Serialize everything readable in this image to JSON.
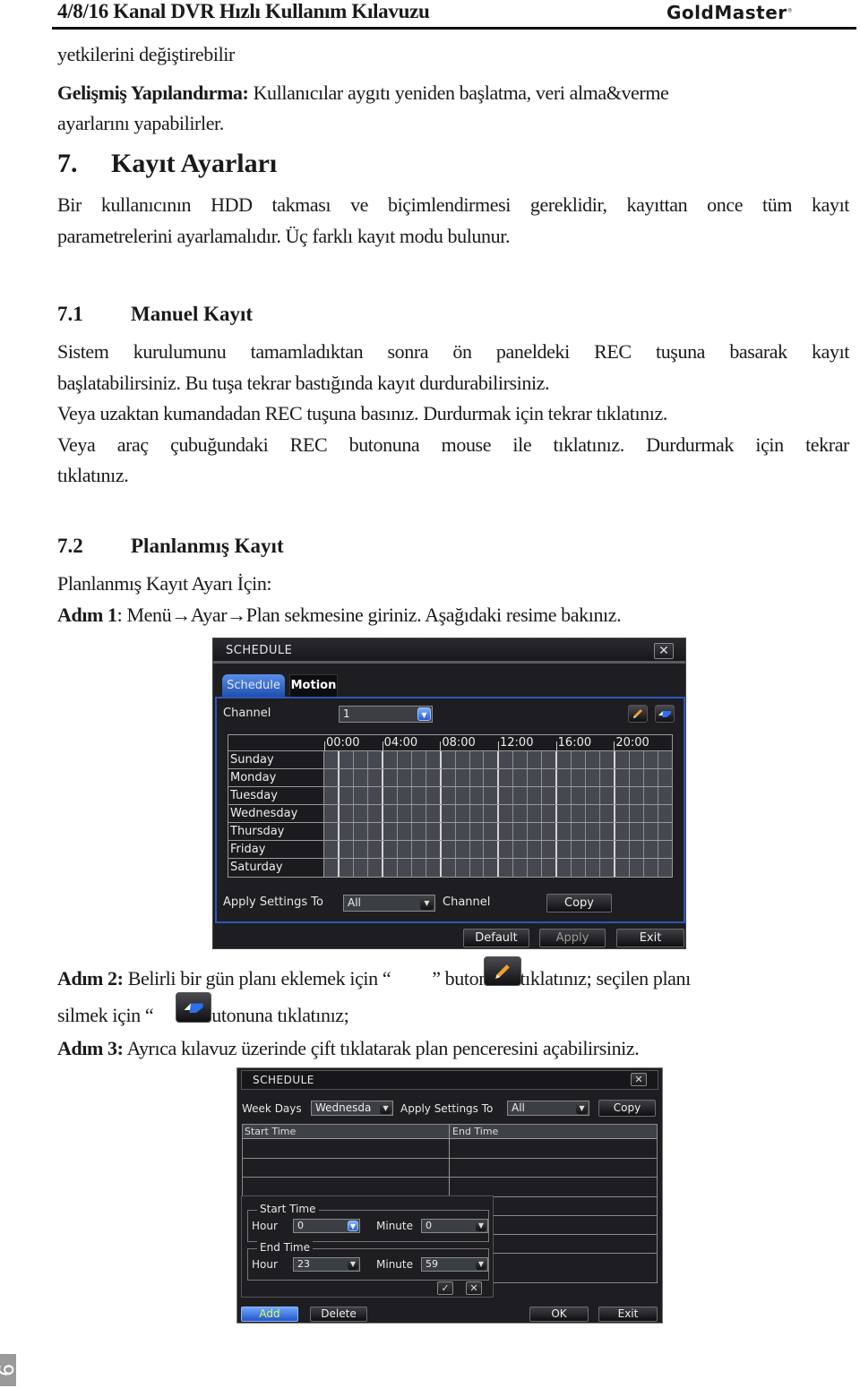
{
  "header": {
    "title": "4/8/16 Kanal DVR Hızlı Kullanım Kılavuzu",
    "brand": "GoldMaster"
  },
  "body": {
    "line_continuation": "yetkilerini değiştirebilir",
    "advanced_label": "Gelişmiş Yapılandırma:",
    "advanced_text_1": " Kullanıcılar aygıtı yeniden başlatma, veri alma&verme",
    "advanced_text_2": "ayarlarını yapabilirler.",
    "section7_number": "7.",
    "section7_title": "Kayıt Ayarları",
    "section7_text_1": "Bir kullanıcının HDD takması ve biçimlendirmesi gereklidir, kayıttan once tüm kayıt",
    "section7_text_2": "parametrelerini ayarlamalıdır. Üç farklı kayıt modu bulunur.",
    "section71_number": "7.1",
    "section71_title": "Manuel Kayıt",
    "section71_text_1": "Sistem kurulumunu tamamladıktan sonra ön paneldeki REC tuşuna basarak kayıt",
    "section71_text_2": "başlatabilirsiniz. Bu tuşa tekrar bastığında kayıt durdurabilirsiniz.",
    "section71_text_3": "Veya uzaktan kumandadan REC tuşuna basınız. Durdurmak için tekrar tıklatınız.",
    "section71_text_4": "Veya araç çubuğundaki REC butonuna mouse ile tıklatınız. Durdurmak için tekrar",
    "section71_text_5": "tıklatınız.",
    "section72_number": "7.2",
    "section72_title": "Planlanmış Kayıt",
    "section72_intro": "Planlanmış Kayıt Ayarı İçin:",
    "step1_label": "Adım 1",
    "step1_text": ": Menü→Ayar→Plan sekmesine giriniz. Aşağıdaki resime bakınız.",
    "step2_label": "Adım 2:",
    "step2_text_a": " Belirli bir gün planı eklemek için “",
    "step2_text_b": "” butonuna tıklatınız; seçilen planı",
    "step2_text_c": "silmek için “",
    "step2_text_d": "” butonuna tıklatınız;",
    "step3_label": "Adım 3:",
    "step3_text": " Ayrıca kılavuz üzerinde çift tıklatarak plan penceresini açabilirsiniz."
  },
  "schedule_dialog": {
    "title": "SCHEDULE",
    "close": "✕",
    "tabs": [
      {
        "label": "Schedule",
        "active": true
      },
      {
        "label": "Motion",
        "active": false
      }
    ],
    "channel_label": "Channel",
    "channel_value": "1",
    "edit_icon": "pencil-icon",
    "erase_icon": "eraser-icon",
    "time_ticks": [
      "00:00",
      "04:00",
      "08:00",
      "12:00",
      "16:00",
      "20:00"
    ],
    "days": [
      "Sunday",
      "Monday",
      "Tuesday",
      "Wednesday",
      "Thursday",
      "Friday",
      "Saturday"
    ],
    "hours_per_day": 24,
    "apply_settings_label": "Apply Settings To",
    "apply_settings_value": "All",
    "channel_suffix": "Channel",
    "copy": "Copy",
    "default": "Default",
    "apply": "Apply",
    "exit": "Exit"
  },
  "week_dialog": {
    "title": "SCHEDULE",
    "close": "✕",
    "week_days_label": "Week Days",
    "week_days_value": "Wednesda",
    "apply_settings_label": "Apply Settings To",
    "apply_settings_value": "All",
    "copy": "Copy",
    "col_start": "Start Time",
    "col_end": "End Time",
    "start_group": "Start Time",
    "end_group": "End Time",
    "hour_label": "Hour",
    "minute_label": "Minute",
    "start_hour": "0",
    "start_minute": "0",
    "end_hour": "23",
    "end_minute": "59",
    "confirm": "✓",
    "cancel": "✕",
    "add": "Add",
    "delete": "Delete",
    "ok": "OK",
    "exit": "Exit"
  },
  "page_number": "6"
}
